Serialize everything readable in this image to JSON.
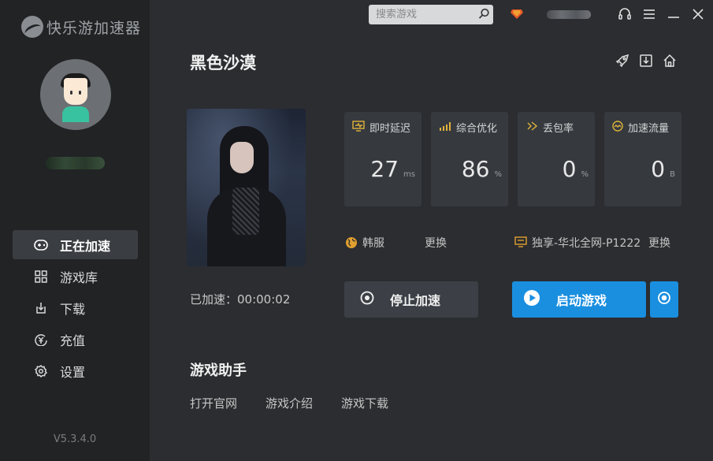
{
  "app": {
    "logo_text": "快乐游加速器",
    "version": "V5.3.4.0"
  },
  "search": {
    "placeholder": "搜索游戏"
  },
  "nav": [
    {
      "label": "正在加速",
      "icon": "gamepad-icon",
      "active": true
    },
    {
      "label": "游戏库",
      "icon": "grid-icon",
      "active": false
    },
    {
      "label": "下载",
      "icon": "download-icon",
      "active": false
    },
    {
      "label": "充值",
      "icon": "recharge-icon",
      "active": false
    },
    {
      "label": "设置",
      "icon": "gear-icon",
      "active": false
    }
  ],
  "game": {
    "title": "黑色沙漠",
    "accelerated_label": "已加速：00:00:02"
  },
  "stats": [
    {
      "label": "即时延迟",
      "value": "27",
      "unit": "ms",
      "icon": "latency-icon"
    },
    {
      "label": "综合优化",
      "value": "86",
      "unit": "%",
      "icon": "optimize-icon"
    },
    {
      "label": "丢包率",
      "value": "0",
      "unit": "%",
      "icon": "packet-loss-icon"
    },
    {
      "label": "加速流量",
      "value": "0",
      "unit": "B",
      "icon": "traffic-icon"
    }
  ],
  "region": {
    "server": "韩服",
    "change1": "更换",
    "node": "独享-华北全网-P1222",
    "change2": "更换"
  },
  "buttons": {
    "stop": "停止加速",
    "start": "启动游戏"
  },
  "helper": {
    "title": "游戏助手",
    "links": [
      "打开官网",
      "游戏介绍",
      "游戏下载"
    ]
  },
  "colors": {
    "accent": "#1a8fe0",
    "sidebar": "#212325",
    "content": "#2b2d30",
    "gem": "#e8562a"
  }
}
